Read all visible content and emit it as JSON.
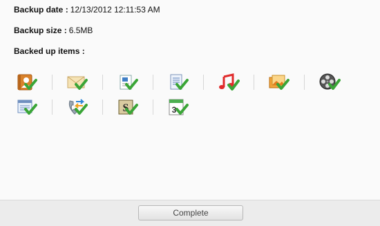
{
  "info": {
    "backup_date_label": "Backup date :",
    "backup_date_value": "12/13/2012 12:11:53 AM",
    "backup_size_label": "Backup size :",
    "backup_size_value": "6.5MB",
    "backed_up_items_label": "Backed up items :"
  },
  "items": [
    {
      "icon": "contacts-icon"
    },
    {
      "icon": "messages-icon"
    },
    {
      "icon": "call-logs-icon"
    },
    {
      "icon": "notes-icon"
    },
    {
      "icon": "music-icon"
    },
    {
      "icon": "photos-icon"
    },
    {
      "icon": "videos-icon"
    },
    {
      "icon": "documents-icon"
    },
    {
      "icon": "call-forwarding-icon"
    },
    {
      "icon": "apps-icon"
    },
    {
      "icon": "calendar-icon"
    }
  ],
  "calendar_day": "3",
  "apps_glyph": "S",
  "footer": {
    "complete_label": "Complete"
  },
  "colors": {
    "check": "#3aa537",
    "accent_orange": "#e3822a",
    "music_red": "#e02b2b"
  }
}
